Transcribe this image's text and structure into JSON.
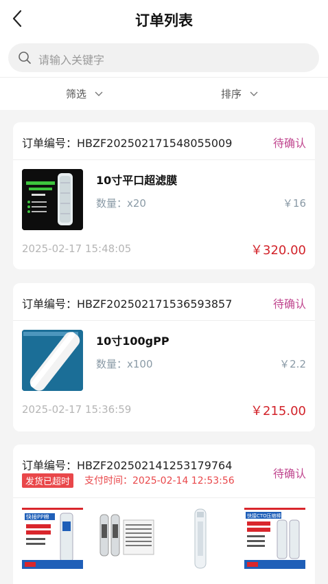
{
  "header": {
    "title": "订单列表"
  },
  "search": {
    "placeholder": "请输入关键字"
  },
  "filters": {
    "filter_label": "筛选",
    "sort_label": "排序"
  },
  "orders": [
    {
      "order_no": "订单编号：HBZF202502171548055009",
      "status": "待确认",
      "product": {
        "name": "10寸平口超滤膜",
        "qty": "数量：x20",
        "price": "￥16",
        "image_text": "高精度超滤膜 UF滤芯 10寸"
      },
      "time": "2025-02-17 15:48:05",
      "total": "￥320.00"
    },
    {
      "order_no": "订单编号：HBZF202502171536593857",
      "status": "待确认",
      "product": {
        "name": "10寸100gPP",
        "qty": "数量：x100",
        "price": "￥2.2"
      },
      "time": "2025-02-17 15:36:59",
      "total": "￥215.00"
    },
    {
      "order_no": "订单编号：HBZF202502141253179764",
      "status": "待确认",
      "overdue_badge": "发货已超时",
      "pay_time": "支付时间：2025-02-14 12:53:56",
      "thumb_texts": [
        "快接PP棉",
        "快接CTO压缩棒"
      ]
    }
  ]
}
